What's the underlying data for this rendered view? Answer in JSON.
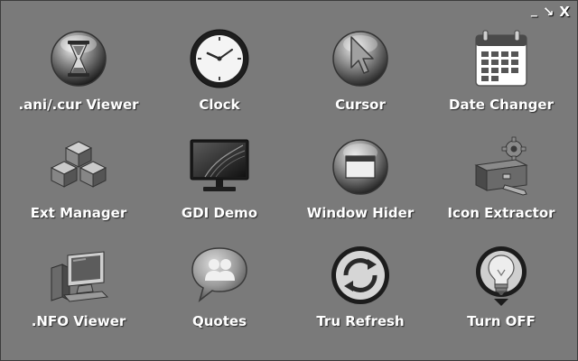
{
  "window": {
    "controls": {
      "minimize": "_",
      "restore": "↘",
      "close": "X"
    }
  },
  "apps": [
    {
      "label": ".ani/.cur Viewer",
      "icon": "hourglass-icon"
    },
    {
      "label": "Clock",
      "icon": "clock-icon"
    },
    {
      "label": "Cursor",
      "icon": "cursor-icon"
    },
    {
      "label": "Date Changer",
      "icon": "calendar-icon"
    },
    {
      "label": "Ext Manager",
      "icon": "cubes-icon"
    },
    {
      "label": "GDI Demo",
      "icon": "monitor-icon"
    },
    {
      "label": "Window Hider",
      "icon": "window-icon"
    },
    {
      "label": "Icon Extractor",
      "icon": "toolbox-icon"
    },
    {
      "label": ".NFO Viewer",
      "icon": "computer-icon"
    },
    {
      "label": "Quotes",
      "icon": "chat-bubble-icon"
    },
    {
      "label": "Tru Refresh",
      "icon": "refresh-icon"
    },
    {
      "label": "Turn OFF",
      "icon": "lightbulb-icon"
    }
  ]
}
